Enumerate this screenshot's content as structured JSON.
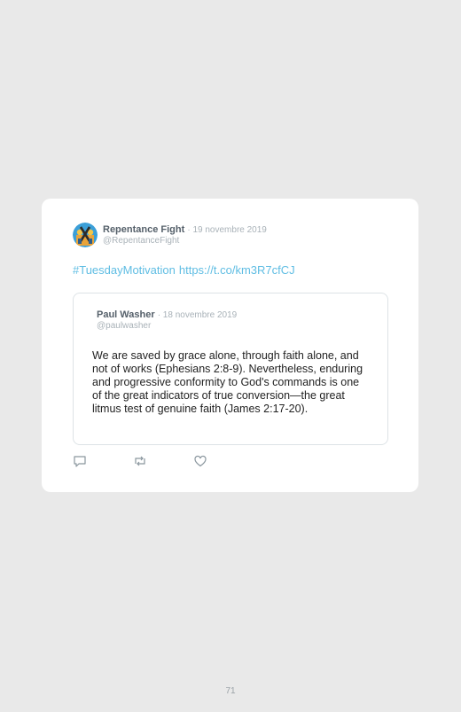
{
  "tweet": {
    "author_name": "Repentance Fight",
    "date": "· 19 novembre 2019",
    "handle": "@RepentanceFight",
    "hashtag": "#TuesdayMotivation",
    "link": "https://t.co/km3R7cfCJ",
    "avatar_icon": "cross-shield-avatar-icon"
  },
  "quoted_tweet": {
    "author_name": "Paul Washer",
    "date": "· 18 novembre 2019",
    "handle": "@paulwasher",
    "text": "We are saved by grace alone, through faith alone, and not of works (Ephesians 2:8-9). Nevertheless, enduring and progressive conformity to God's commands is one of the great indicators of true conversion—the great litmus test of genuine faith (James 2:17-20)."
  },
  "actions": [
    {
      "icon": "reply-icon"
    },
    {
      "icon": "retweet-icon"
    },
    {
      "icon": "like-icon"
    }
  ],
  "page_number": "71",
  "colors": {
    "background": "#e9e9e9",
    "card": "#ffffff",
    "link": "#5fbde3",
    "muted": "#a9b2b8",
    "name": "#55606a"
  }
}
